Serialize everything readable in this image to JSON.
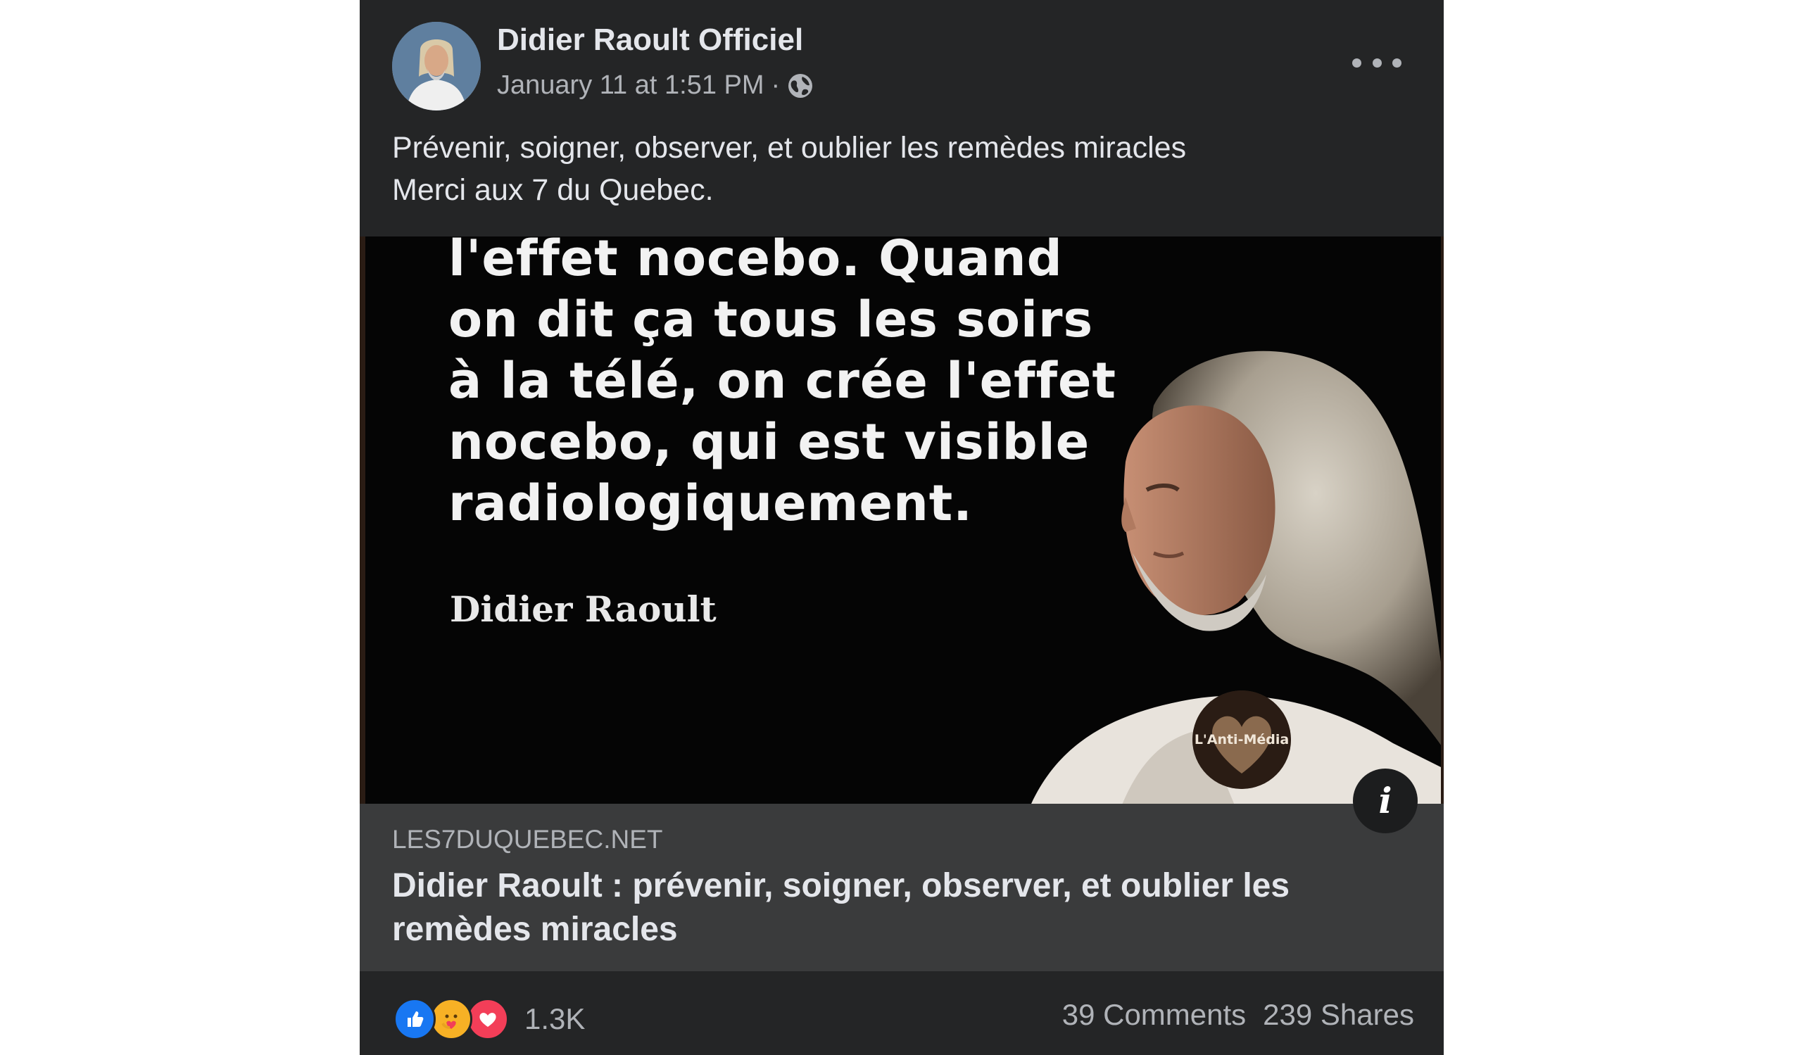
{
  "post": {
    "author": "Didier Raoult Officiel",
    "timestamp": "January 11 at 1:51 PM",
    "separator": "·",
    "audience_icon": "globe-icon",
    "more_icon": "more-options-icon",
    "caption_lines": [
      "Prévenir, soigner, observer, et oublier les remèdes miracles",
      "Merci aux 7 du Quebec."
    ]
  },
  "image": {
    "quote_lines": [
      "l'effet nocebo. Quand",
      "on dit ça tous les soirs",
      "à la télé, on crée l'effet",
      "nocebo, qui est visible",
      "radiologiquement."
    ],
    "signature": "Didier Raoult",
    "watermark": "L'Anti-Média",
    "info_icon": "info-icon",
    "info_glyph": "i"
  },
  "link_preview": {
    "domain": "LES7DUQUEBEC.NET",
    "title_lines": [
      "Didier Raoult : prévenir, soigner, observer, et oublier les",
      "remèdes miracles"
    ]
  },
  "engagement": {
    "reaction_icons": [
      "like-icon",
      "care-icon",
      "love-icon"
    ],
    "reactions_count": "1.3K",
    "comments": "39 Comments",
    "shares": "239 Shares"
  },
  "colors": {
    "post_background": "#242526",
    "link_background": "#3a3b3c",
    "primary_text": "#e4e6eb",
    "secondary_text": "#b0b3b8",
    "like_blue": "#1877f2",
    "care_yellow": "#f7b125",
    "love_red": "#f33e58"
  }
}
